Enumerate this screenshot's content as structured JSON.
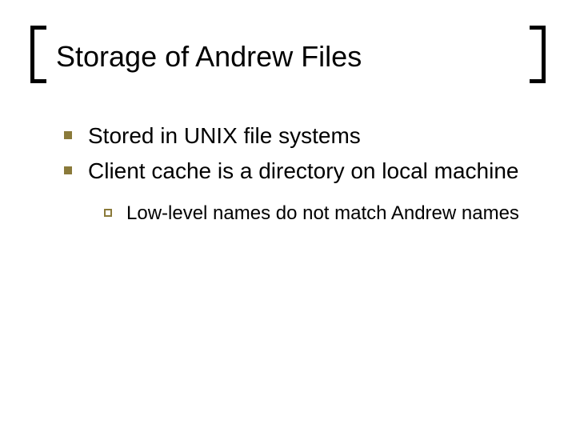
{
  "slide": {
    "title": "Storage of Andrew Files",
    "bullets": [
      {
        "text": "Stored in UNIX file systems"
      },
      {
        "text": "Client cache is a directory on local machine"
      }
    ],
    "subbullets": [
      {
        "text": "Low-level names do not match Andrew names"
      }
    ]
  },
  "colors": {
    "bullet": "#8a7a3a"
  }
}
